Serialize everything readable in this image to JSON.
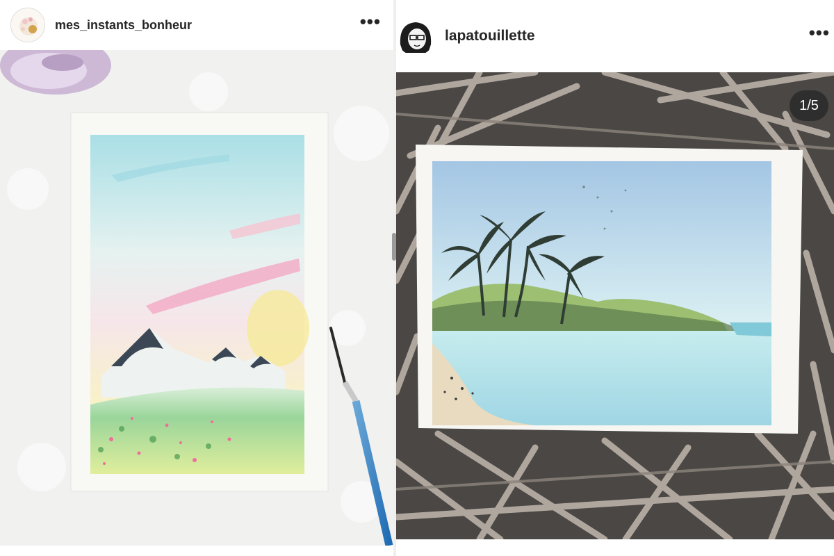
{
  "posts": [
    {
      "username": "mes_instants_bonheur",
      "more_label": "•••",
      "photo_alt": "",
      "avatar_icon": "flower-avatar-icon"
    },
    {
      "username": "lapatouillette",
      "more_label": "•••",
      "photo_alt": "",
      "avatar_icon": "portrait-avatar-icon",
      "carousel_counter": "1/5"
    }
  ],
  "colors": {
    "text": "#262626",
    "counter_bg": "#262626"
  }
}
